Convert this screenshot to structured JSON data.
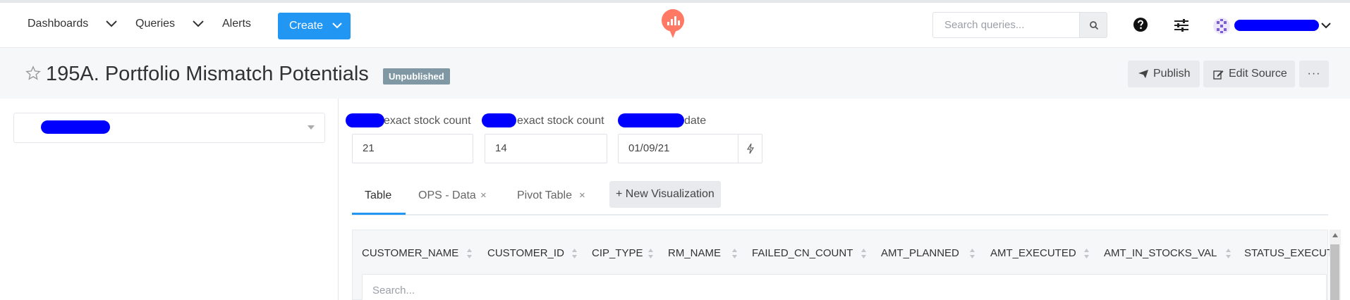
{
  "nav": {
    "dashboards": "Dashboards",
    "queries": "Queries",
    "alerts": "Alerts",
    "create": "Create"
  },
  "search": {
    "placeholder": "Search queries..."
  },
  "query": {
    "title": "195A. Portfolio Mismatch Potentials",
    "status": "Unpublished",
    "publish": "Publish",
    "edit_source": "Edit Source",
    "more": "···"
  },
  "params": [
    {
      "label": "exact stock count",
      "value": "21"
    },
    {
      "label": "exact stock count",
      "value": "14"
    },
    {
      "label": "date",
      "value": "01/09/21"
    }
  ],
  "tabs": {
    "table": "Table",
    "ops_data": "OPS - Data",
    "pivot": "Pivot Table",
    "close": "×",
    "new_viz": "+ New Visualization"
  },
  "table": {
    "columns": [
      "CUSTOMER_NAME",
      "CUSTOMER_ID",
      "CIP_TYPE",
      "RM_NAME",
      "FAILED_CN_COUNT",
      "AMT_PLANNED",
      "AMT_EXECUTED",
      "AMT_IN_STOCKS_VAL",
      "STATUS_EXECUT"
    ],
    "search_placeholder": "Search..."
  },
  "colors": {
    "accent": "#2196f3",
    "badge": "#7f98a4",
    "redaction": "#0000ff",
    "logo": "#ff7964"
  },
  "icons": [
    "chevron-down-icon",
    "logo-icon",
    "search-icon",
    "help-icon",
    "settings-sliders-icon",
    "avatar-icon",
    "star-icon",
    "send-icon",
    "edit-icon",
    "lightning-icon",
    "sort-icon"
  ]
}
